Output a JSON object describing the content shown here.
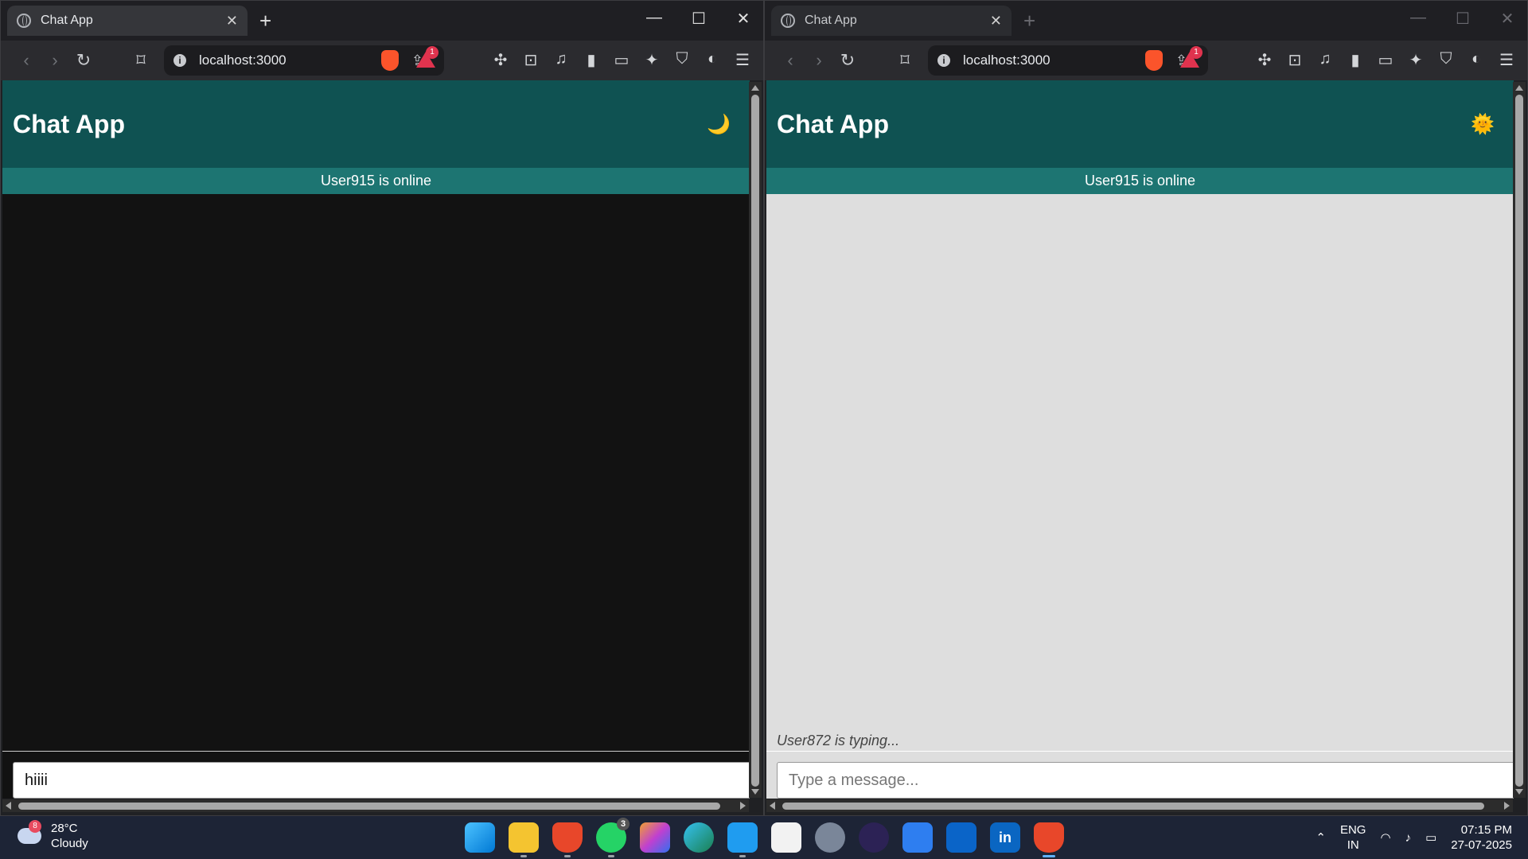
{
  "browser_left": {
    "tab_title": "Chat App",
    "url": "localhost:3000",
    "rewards_count": "1",
    "app": {
      "title": "Chat App",
      "theme_icon": "🌙",
      "status": "User915 is online",
      "typing": "",
      "input_value": "hiiii",
      "input_placeholder": "Type a message...",
      "messages_bg": "#121212"
    }
  },
  "browser_right": {
    "tab_title": "Chat App",
    "url": "localhost:3000",
    "rewards_count": "1",
    "app": {
      "title": "Chat App",
      "theme_icon": "🌞",
      "status": "User915 is online",
      "typing": "User872 is typing...",
      "input_value": "",
      "input_placeholder": "Type a message...",
      "messages_bg": "#dedede"
    }
  },
  "colors": {
    "header_bg": "#0f5252",
    "status_bg": "#1d7572"
  },
  "taskbar": {
    "weather_badge": "8",
    "temperature": "28°C",
    "condition": "Cloudy",
    "whatsapp_badge": "3",
    "lang_top": "ENG",
    "lang_bottom": "IN",
    "time": "07:15 PM",
    "date": "27-07-2025",
    "icons": [
      "start-icon",
      "file-explorer-icon",
      "brave-nightly-icon",
      "whatsapp-icon",
      "copilot-icon",
      "edge-icon",
      "vscode-icon",
      "microsoft-store-icon",
      "settings-icon",
      "eclipse-icon",
      "todo-icon",
      "outlook-icon",
      "linkedin-icon",
      "brave-icon"
    ]
  }
}
